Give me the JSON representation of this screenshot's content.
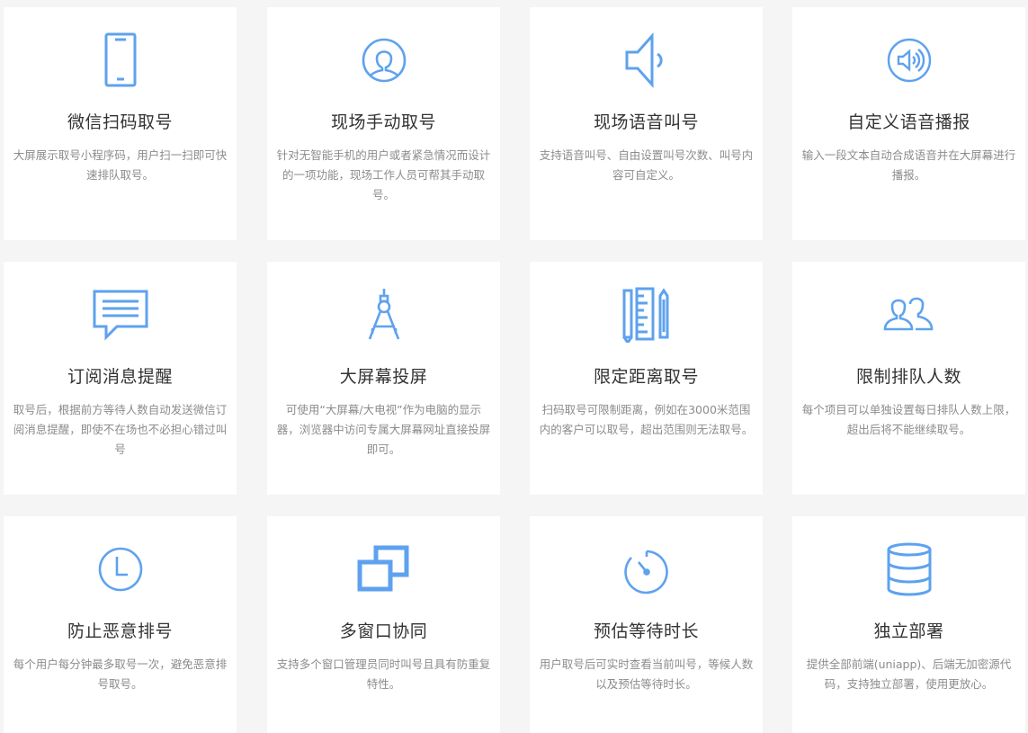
{
  "accent_color": "#5ea2ef",
  "features": [
    {
      "icon": "mobile-phone-icon",
      "title": "微信扫码取号",
      "desc": "大屏展示取号小程序码，用户扫一扫即可快速排队取号。"
    },
    {
      "icon": "user-avatar-icon",
      "title": "现场手动取号",
      "desc": "针对无智能手机的用户或者紧急情况而设计的一项功能，现场工作人员可帮其手动取号。"
    },
    {
      "icon": "speaker-icon",
      "title": "现场语音叫号",
      "desc": "支持语音叫号、自由设置叫号次数、叫号内容可自定义。"
    },
    {
      "icon": "volume-circle-icon",
      "title": "自定义语音播报",
      "desc": "输入一段文本自动合成语音并在大屏幕进行播报。"
    },
    {
      "icon": "message-icon",
      "title": "订阅消息提醒",
      "desc": "取号后，根据前方等待人数自动发送微信订阅消息提醒，即使不在场也不必担心错过叫号"
    },
    {
      "icon": "compass-icon",
      "title": "大屏幕投屏",
      "desc": "可使用“大屏幕/大电视”作为电脑的显示器，浏览器中访问专属大屏幕网址直接投屏即可。"
    },
    {
      "icon": "ruler-pencil-icon",
      "title": "限定距离取号",
      "desc": "扫码取号可限制距离，例如在3000米范围内的客户可以取号，超出范围则无法取号。"
    },
    {
      "icon": "users-icon",
      "title": "限制排队人数",
      "desc": "每个项目可以单独设置每日排队人数上限，超出后将不能继续取号。"
    },
    {
      "icon": "clock-icon",
      "title": "防止恶意排号",
      "desc": "每个用户每分钟最多取号一次，避免恶意排号取号。"
    },
    {
      "icon": "windows-icon",
      "title": "多窗口协同",
      "desc": "支持多个窗口管理员同时叫号且具有防重复特性。"
    },
    {
      "icon": "timer-icon",
      "title": "预估等待时长",
      "desc": "用户取号后可实时查看当前叫号，等候人数以及预估等待时长。"
    },
    {
      "icon": "database-icon",
      "title": "独立部署",
      "desc": "提供全部前端(uniapp)、后端无加密源代码，支持独立部署，使用更放心。"
    }
  ]
}
